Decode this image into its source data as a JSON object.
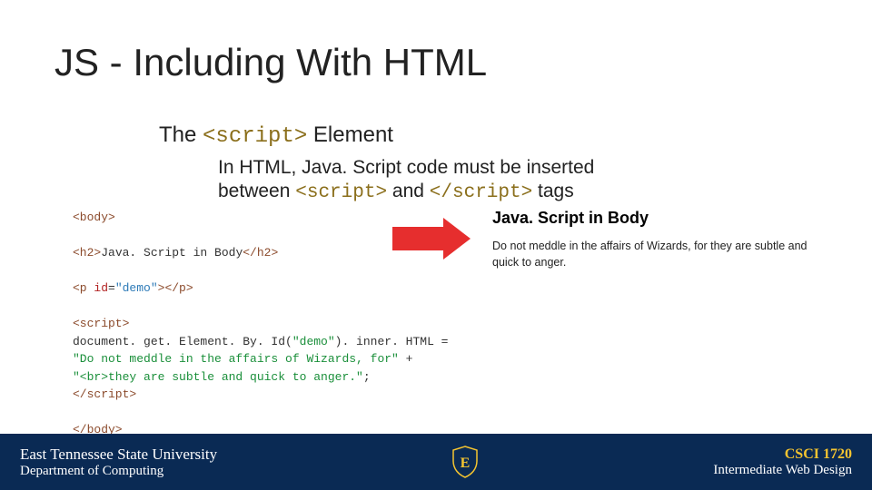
{
  "title": "JS - Including With HTML",
  "subtitle": {
    "pre": "The ",
    "code": "<script>",
    "post": " Element"
  },
  "desc": {
    "line1": "In HTML, Java. Script code must be inserted",
    "line2_pre": "between ",
    "line2_code1": "<script>",
    "line2_mid": " and ",
    "line2_code2": "</script>",
    "line2_post": " tags"
  },
  "code": {
    "body_open": "<body>",
    "h2_open": "<h2>",
    "h2_text": "Java. Script in Body",
    "h2_close": "</h2>",
    "p_open_1": "<p ",
    "p_attr": "id",
    "p_eq": "=",
    "p_val": "\"demo\"",
    "p_open_2": ">",
    "p_close": "</p>",
    "script_open": "<script>",
    "js1_a": "document. get. Element. By. Id(",
    "js1_b": "\"demo\"",
    "js1_c": "). inner. HTML =",
    "js2": "\"Do not meddle in the affairs of Wizards, for\"",
    "js2_plus": " +",
    "js3": "\"<br>they are subtle and quick to anger.\"",
    "js3_semi": ";",
    "script_close": "</script>",
    "body_close": "</body>"
  },
  "render": {
    "title": "Java. Script in Body",
    "text": "Do not meddle in the affairs of Wizards, for they are subtle and quick to anger."
  },
  "footer": {
    "left1": "East Tennessee State University",
    "left2": "Department of Computing",
    "centerGlyph": "E",
    "right1": "CSCI 1720",
    "right2": "Intermediate Web Design"
  }
}
